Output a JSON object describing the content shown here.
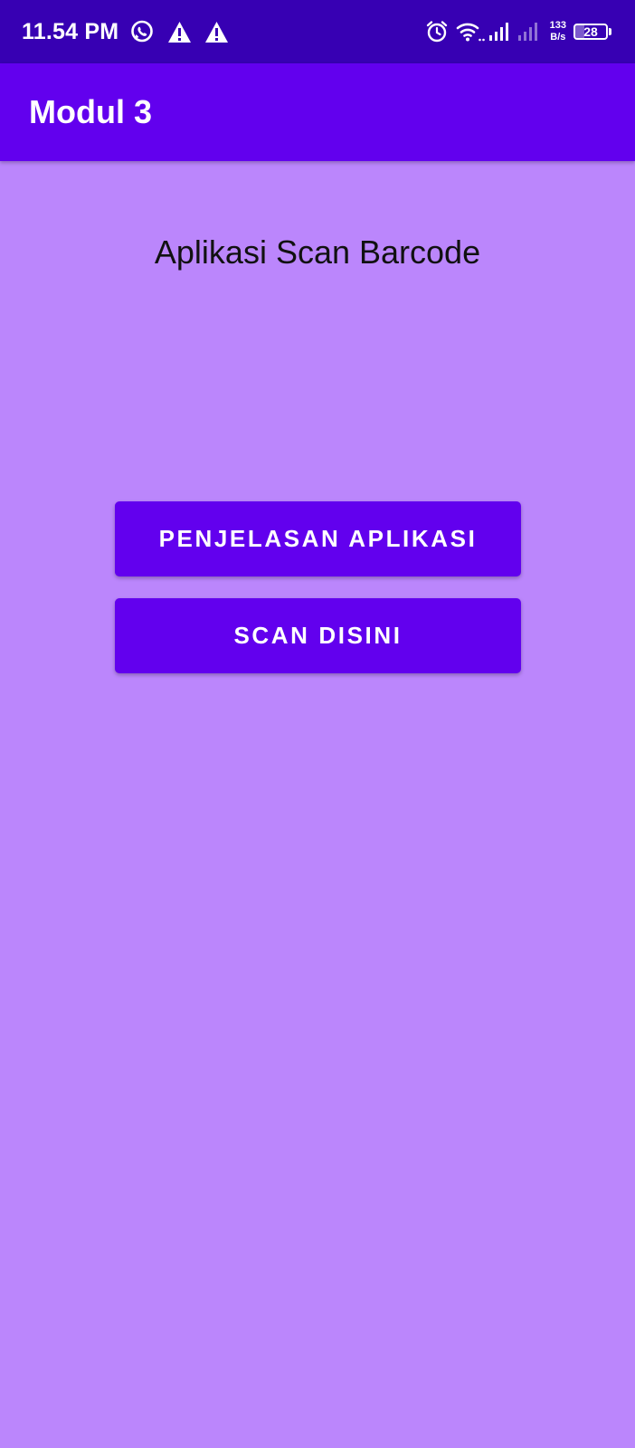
{
  "status_bar": {
    "time": "11.54 PM",
    "net_speed_value": "133",
    "net_speed_unit": "B/s",
    "battery_level": "28",
    "icons": [
      "whatsapp-icon",
      "warning-icon",
      "warning-icon",
      "alarm-icon",
      "wifi-icon",
      "signal-icon",
      "signal-icon",
      "battery-icon"
    ]
  },
  "app_bar": {
    "title": "Modul 3"
  },
  "main": {
    "heading": "Aplikasi Scan Barcode",
    "buttons": {
      "explain_label": "PENJELASAN APLIKASI",
      "scan_label": "SCAN DISINI"
    }
  },
  "colors": {
    "status_bar": "#3700b3",
    "primary": "#6200ee",
    "background": "#bb86fc",
    "on_primary": "#ffffff",
    "text": "#111111"
  }
}
